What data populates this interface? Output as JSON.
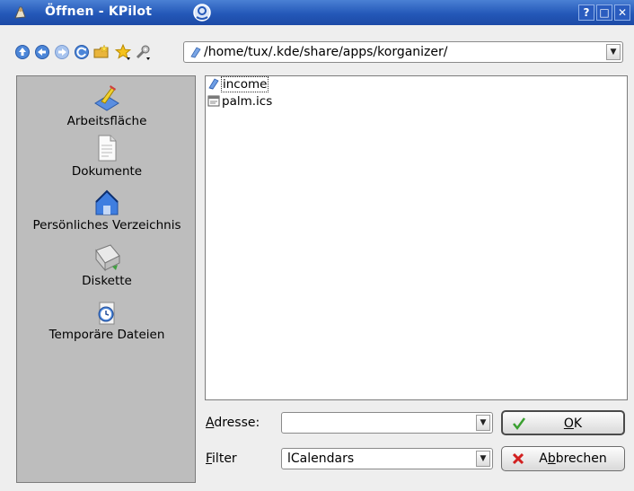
{
  "window": {
    "title": "Öffnen - KPilot",
    "help_label": "?",
    "maximize_label": "□",
    "close_label": "✕"
  },
  "toolbar": {
    "tools": [
      "up-icon",
      "back-icon",
      "forward-icon",
      "reload-icon",
      "new-folder-icon",
      "bookmark-icon",
      "configure-icon"
    ],
    "path": "/home/tux/.kde/share/apps/korganizer/"
  },
  "sidebar": {
    "places": [
      {
        "label": "Arbeitsfläche",
        "icon": "desktop-icon"
      },
      {
        "label": "Dokumente",
        "icon": "documents-icon"
      },
      {
        "label": "Persönliches Verzeichnis",
        "icon": "home-icon"
      },
      {
        "label": "Diskette",
        "icon": "floppy-icon"
      },
      {
        "label": "Temporäre Dateien",
        "icon": "temp-folder-icon"
      }
    ]
  },
  "files": [
    {
      "name": "income",
      "icon": "folder-link-icon",
      "selected": true
    },
    {
      "name": "palm.ics",
      "icon": "calendar-file-icon",
      "selected": false
    }
  ],
  "form": {
    "address_label": "Adresse:",
    "address_value": "",
    "filter_label": "Filter",
    "filter_value": "lCalendars"
  },
  "buttons": {
    "ok_label": "OK",
    "cancel_label": "Abbrechen"
  },
  "colors": {
    "titlebar": "#2458b8",
    "sidebar_bg": "#bdbdbd",
    "ok_check": "#3aa030",
    "cancel_x": "#d22020"
  }
}
